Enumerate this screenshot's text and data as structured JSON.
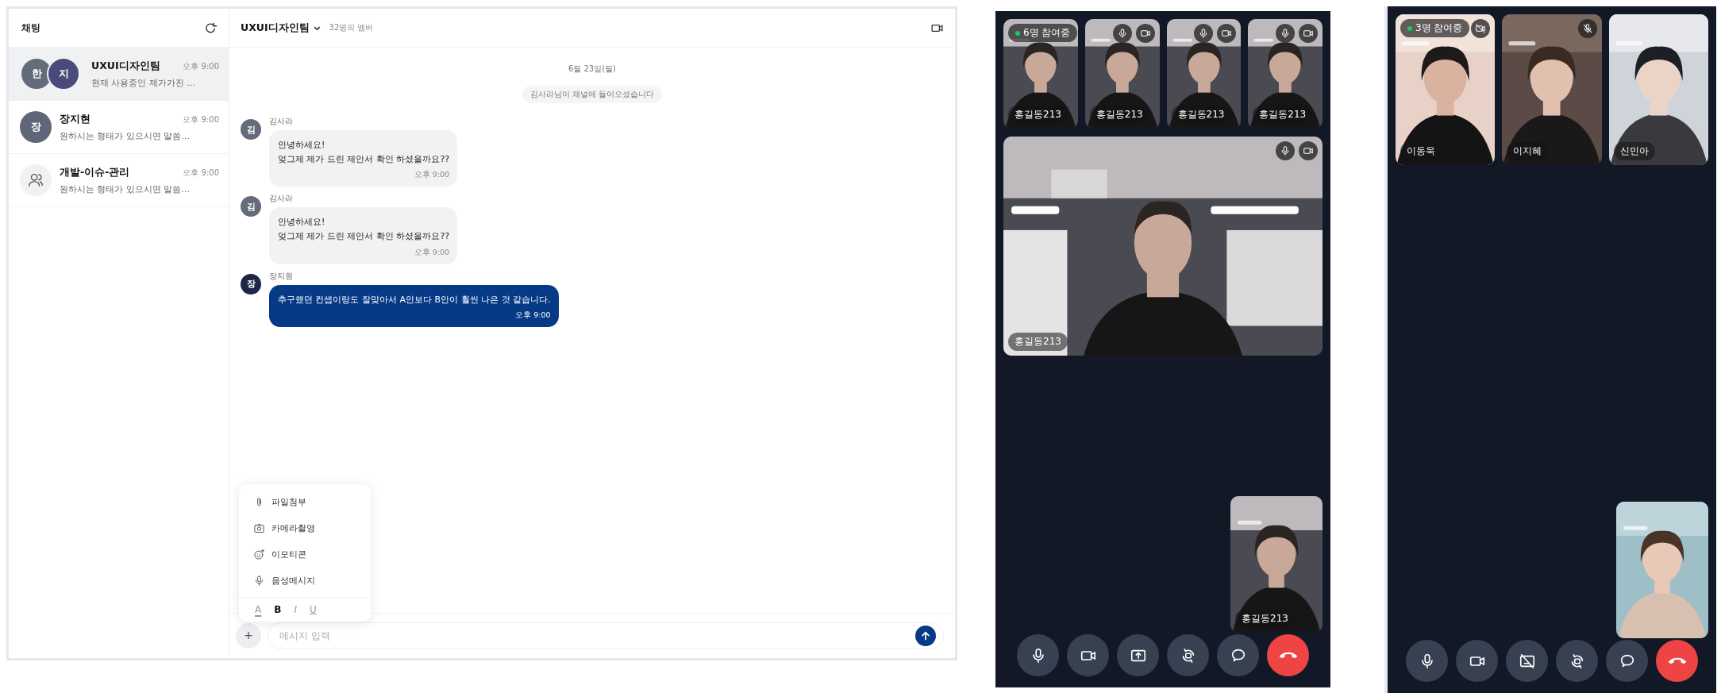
{
  "chat_app": {
    "sidebar": {
      "title": "채팅",
      "chats": [
        {
          "kind": "group",
          "name": "UXUI디자인팀",
          "preview": "현재 사용중인 제가가진 ...",
          "time": "오후 9:00",
          "selected": true,
          "avatars": [
            {
              "initial": "한",
              "color": "#646b7b"
            },
            {
              "initial": "지",
              "color": "#4a4b7c"
            }
          ]
        },
        {
          "kind": "person",
          "name": "장지현",
          "preview": "원하시는 형태가 있으시면 말씀...",
          "time": "오후 9:00",
          "selected": false,
          "avatars": [
            {
              "initial": "장",
              "color": "#5f6678"
            }
          ]
        },
        {
          "kind": "channel",
          "name": "개발-이슈-관리",
          "preview": "원하시는 형태가 있으시면 말씀...",
          "time": "오후 9:00",
          "selected": false
        }
      ]
    },
    "header": {
      "title": "UXUI디자인팀",
      "members": "32명의 멤버"
    },
    "date": "6월 23일(월)",
    "notice": "김사라님이 채널에 들어오셨습니다",
    "messages": [
      {
        "sender": "김사라",
        "initial": "김",
        "color": "#646b7b",
        "mine": false,
        "text": "안녕하세요!\n엊그제 제가 드린 제안서 확인 하셨을까요??",
        "time": "오후 9:00"
      },
      {
        "sender": "김사라",
        "initial": "김",
        "color": "#646b7b",
        "mine": false,
        "text": "안녕하세요!\n엊그제 제가 드린 제안서 확인 하셨을까요??",
        "time": "오후 9:00"
      },
      {
        "sender": "장지원",
        "initial": "장",
        "color": "#1c2647",
        "mine": true,
        "text": "추구했던 컨셉이랑도 잘맞아서 A안보다 B안이 훨씬 나은 것 같습니다.",
        "time": "오후 9:00"
      }
    ],
    "attach_menu": {
      "items": [
        {
          "kind": "file",
          "label": "파일첨부"
        },
        {
          "kind": "camera",
          "label": "카메라촬영"
        },
        {
          "kind": "emoji",
          "label": "이모티콘"
        },
        {
          "kind": "voice",
          "label": "음성메시지"
        }
      ],
      "format": [
        {
          "kind": "color",
          "label": "A"
        },
        {
          "kind": "bold",
          "label": "B"
        },
        {
          "kind": "italic",
          "label": "I"
        },
        {
          "kind": "underline",
          "label": "U"
        }
      ]
    },
    "composer": {
      "add": "+",
      "placeholder": "메시지 입력"
    }
  },
  "calls": [
    {
      "badge": "6명 참여중",
      "tiles": [
        {
          "name": "홍길동213"
        },
        {
          "name": "홍길동213",
          "icons": [
            {
              "kind": "mic"
            },
            {
              "kind": "camera"
            }
          ]
        },
        {
          "name": "홍길동213",
          "icons": [
            {
              "kind": "mic"
            },
            {
              "kind": "camera"
            }
          ]
        },
        {
          "name": "홍길동213",
          "icons": [
            {
              "kind": "mic"
            },
            {
              "kind": "camera"
            }
          ]
        }
      ],
      "main": {
        "name": "홍길동213",
        "icons": [
          {
            "kind": "mic"
          },
          {
            "kind": "camera"
          }
        ]
      },
      "self_view": {
        "kind": "picture",
        "name": "홍길동213"
      },
      "controls": [
        {
          "kind": "mic"
        },
        {
          "kind": "camera"
        },
        {
          "kind": "screen_share"
        },
        {
          "kind": "rotate_camera"
        },
        {
          "kind": "chat"
        },
        {
          "kind": "hang_up"
        }
      ]
    },
    {
      "badge": "3명 참여중",
      "tiles": [
        {
          "name": "이동욱",
          "icons": [
            {
              "kind": "camera_off"
            }
          ]
        },
        {
          "name": "이지혜",
          "icons": [
            {
              "kind": "mic_off"
            }
          ]
        },
        {
          "name": "신민아"
        }
      ],
      "self_view": {
        "kind": "picture"
      },
      "controls": [
        {
          "kind": "mic"
        },
        {
          "kind": "camera"
        },
        {
          "kind": "screen_share_off"
        },
        {
          "kind": "rotate_camera"
        },
        {
          "kind": "chat"
        },
        {
          "kind": "hang_up"
        }
      ]
    }
  ]
}
